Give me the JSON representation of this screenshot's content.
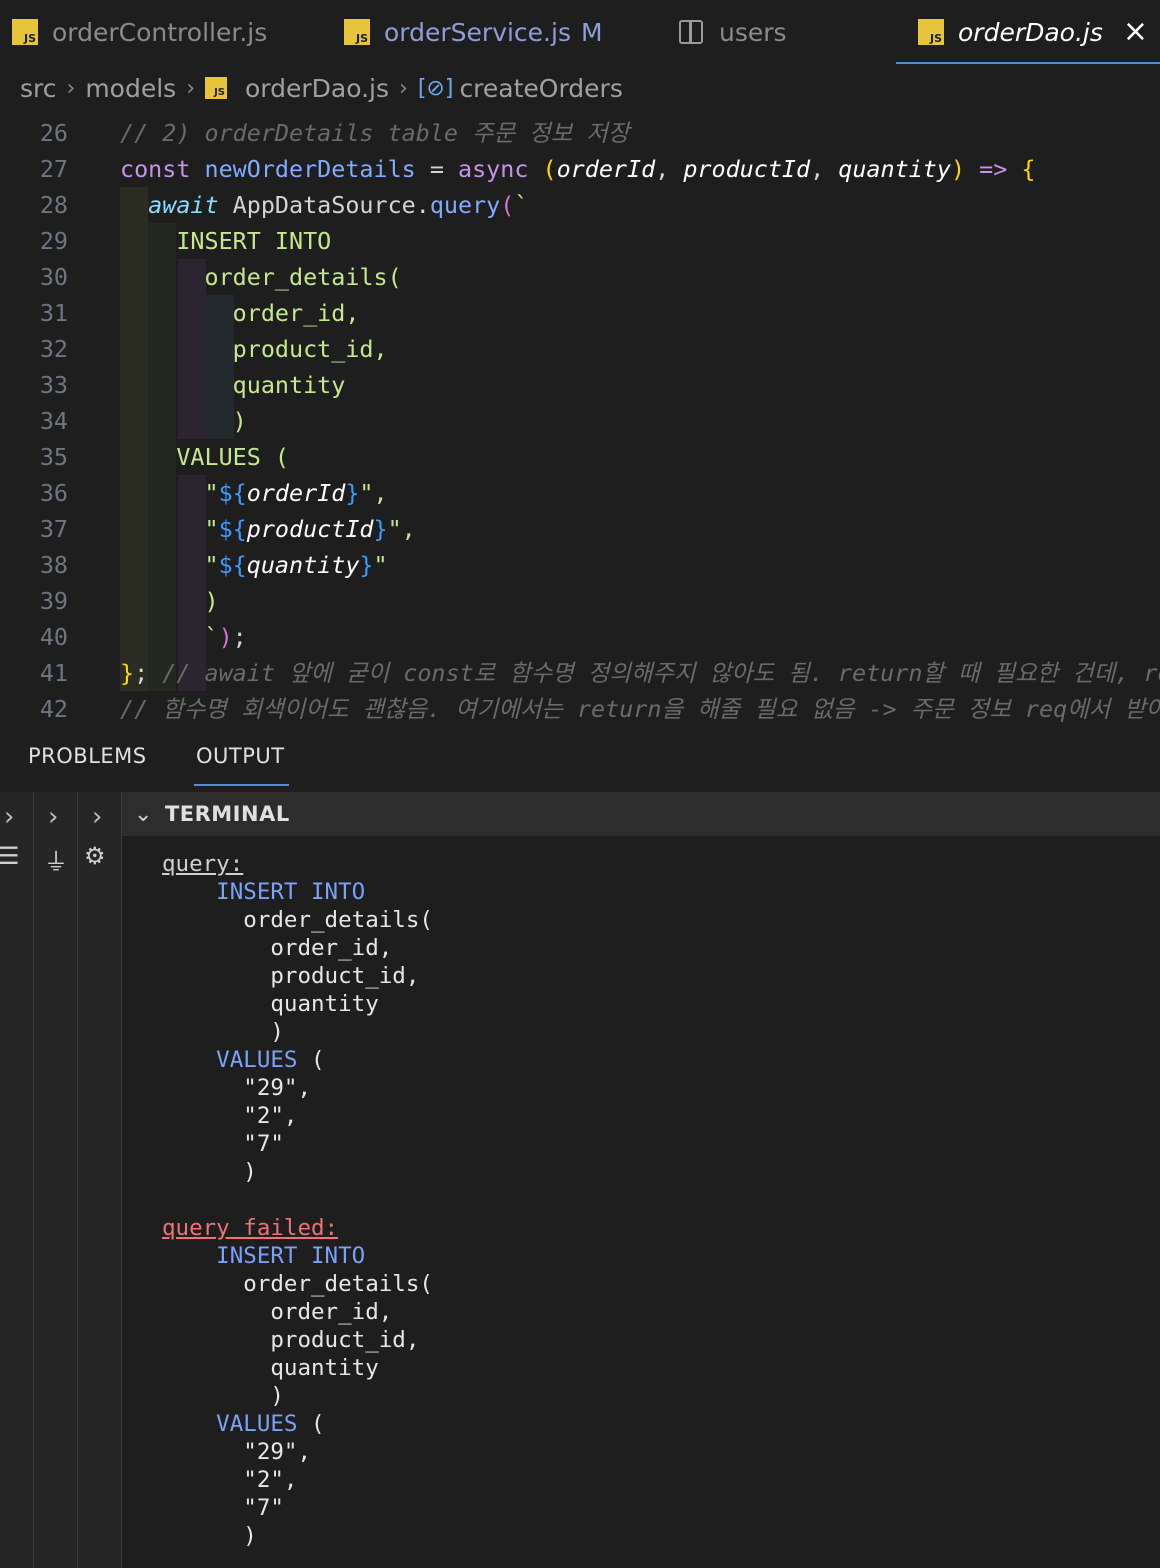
{
  "tabs": [
    {
      "label": "orderController.js",
      "icon": "js-file-icon"
    },
    {
      "label": "orderService.js",
      "icon": "js-file-icon",
      "badge": "M"
    },
    {
      "label": "users",
      "icon": "split-editor-icon"
    },
    {
      "label": "orderDao.js",
      "icon": "js-file-icon",
      "close": "×"
    }
  ],
  "breadcrumb": {
    "parts": [
      "src",
      "models",
      "orderDao.js",
      "createOrders"
    ],
    "separator": "›",
    "js_icon": "JS"
  },
  "editor": {
    "lines": [
      {
        "n": "26",
        "segs": [
          [
            "c",
            "// 2) orderDetails table 주문 정보 저장"
          ]
        ]
      },
      {
        "n": "27",
        "segs": [
          [
            "k",
            "const "
          ],
          [
            "f",
            "newOrderDetails"
          ],
          [
            "p",
            " = "
          ],
          [
            "k",
            "async "
          ],
          [
            "br",
            "("
          ],
          [
            "param",
            "orderId"
          ],
          [
            "p",
            ", "
          ],
          [
            "param",
            "productId"
          ],
          [
            "p",
            ", "
          ],
          [
            "param",
            "quantity"
          ],
          [
            "br",
            ")"
          ],
          [
            "p",
            " "
          ],
          [
            "op",
            "=>"
          ],
          [
            "p",
            " "
          ],
          [
            "br",
            "{"
          ]
        ]
      },
      {
        "n": "28",
        "segs": [
          [
            "p",
            "  "
          ],
          [
            "kit",
            "await"
          ],
          [
            "p",
            " AppDataSource."
          ],
          [
            "f",
            "query"
          ],
          [
            "br2",
            "("
          ],
          [
            "s",
            "`"
          ]
        ]
      },
      {
        "n": "29",
        "segs": [
          [
            "s",
            "    INSERT INTO"
          ]
        ]
      },
      {
        "n": "30",
        "segs": [
          [
            "s",
            "      order_details("
          ]
        ]
      },
      {
        "n": "31",
        "segs": [
          [
            "s",
            "        order_id,"
          ]
        ]
      },
      {
        "n": "32",
        "segs": [
          [
            "s",
            "        product_id,"
          ]
        ]
      },
      {
        "n": "33",
        "segs": [
          [
            "s",
            "        quantity"
          ]
        ]
      },
      {
        "n": "34",
        "segs": [
          [
            "s",
            "        )"
          ]
        ]
      },
      {
        "n": "35",
        "segs": [
          [
            "s",
            "    VALUES ("
          ]
        ]
      },
      {
        "n": "36",
        "segs": [
          [
            "s",
            "      \""
          ],
          [
            "tp",
            "${"
          ],
          [
            "param",
            "orderId"
          ],
          [
            "tp",
            "}"
          ],
          [
            "s",
            "\","
          ]
        ]
      },
      {
        "n": "37",
        "segs": [
          [
            "s",
            "      \""
          ],
          [
            "tp",
            "${"
          ],
          [
            "param",
            "productId"
          ],
          [
            "tp",
            "}"
          ],
          [
            "s",
            "\","
          ]
        ]
      },
      {
        "n": "38",
        "segs": [
          [
            "s",
            "      \""
          ],
          [
            "tp",
            "${"
          ],
          [
            "param",
            "quantity"
          ],
          [
            "tp",
            "}"
          ],
          [
            "s",
            "\""
          ]
        ]
      },
      {
        "n": "39",
        "segs": [
          [
            "s",
            "      )"
          ]
        ]
      },
      {
        "n": "40",
        "segs": [
          [
            "s",
            "      `"
          ],
          [
            "br2",
            ")"
          ],
          [
            "p",
            ";"
          ]
        ]
      },
      {
        "n": "41",
        "segs": [
          [
            "br",
            "}"
          ],
          [
            "p",
            "; "
          ],
          [
            "c",
            "// await 앞에 굳이 const로 함수명 정의해주지 않아도 됨. return할 때 필요한 건데, re"
          ]
        ]
      },
      {
        "n": "42",
        "segs": [
          [
            "c",
            "// 함수명 회색이어도 괜찮음. 여기에서는 return을 해줄 필요 없음 -> 주문 정보 req에서 받아와"
          ]
        ]
      }
    ]
  },
  "panel": {
    "tabs": [
      "PROBLEMS",
      "OUTPUT"
    ],
    "terminal_title": "TERMINAL",
    "log": [
      {
        "type": "label",
        "text": "query:"
      },
      {
        "type": "kw",
        "text": "    INSERT INTO"
      },
      {
        "type": "plain",
        "text": "      order_details("
      },
      {
        "type": "plain",
        "text": "        order_id,"
      },
      {
        "type": "plain",
        "text": "        product_id,"
      },
      {
        "type": "plain",
        "text": "        quantity"
      },
      {
        "type": "plain",
        "text": "        )"
      },
      {
        "type": "kwp",
        "kw": "    VALUES",
        "rest": " ("
      },
      {
        "type": "plain",
        "text": "      \"29\","
      },
      {
        "type": "plain",
        "text": "      \"2\","
      },
      {
        "type": "plain",
        "text": "      \"7\""
      },
      {
        "type": "plain",
        "text": "      )"
      },
      {
        "type": "blank",
        "text": ""
      },
      {
        "type": "fail",
        "text": "query failed:"
      },
      {
        "type": "kw",
        "text": "    INSERT INTO"
      },
      {
        "type": "plain",
        "text": "      order_details("
      },
      {
        "type": "plain",
        "text": "        order_id,"
      },
      {
        "type": "plain",
        "text": "        product_id,"
      },
      {
        "type": "plain",
        "text": "        quantity"
      },
      {
        "type": "plain",
        "text": "        )"
      },
      {
        "type": "kwp",
        "kw": "    VALUES",
        "rest": " ("
      },
      {
        "type": "plain",
        "text": "      \"29\","
      },
      {
        "type": "plain",
        "text": "      \"2\","
      },
      {
        "type": "plain",
        "text": "      \"7\""
      },
      {
        "type": "plain",
        "text": "      )"
      }
    ]
  },
  "colors": {
    "accent": "#4c8fd6",
    "js_icon": "#e7c53b",
    "error": "#f07178"
  }
}
